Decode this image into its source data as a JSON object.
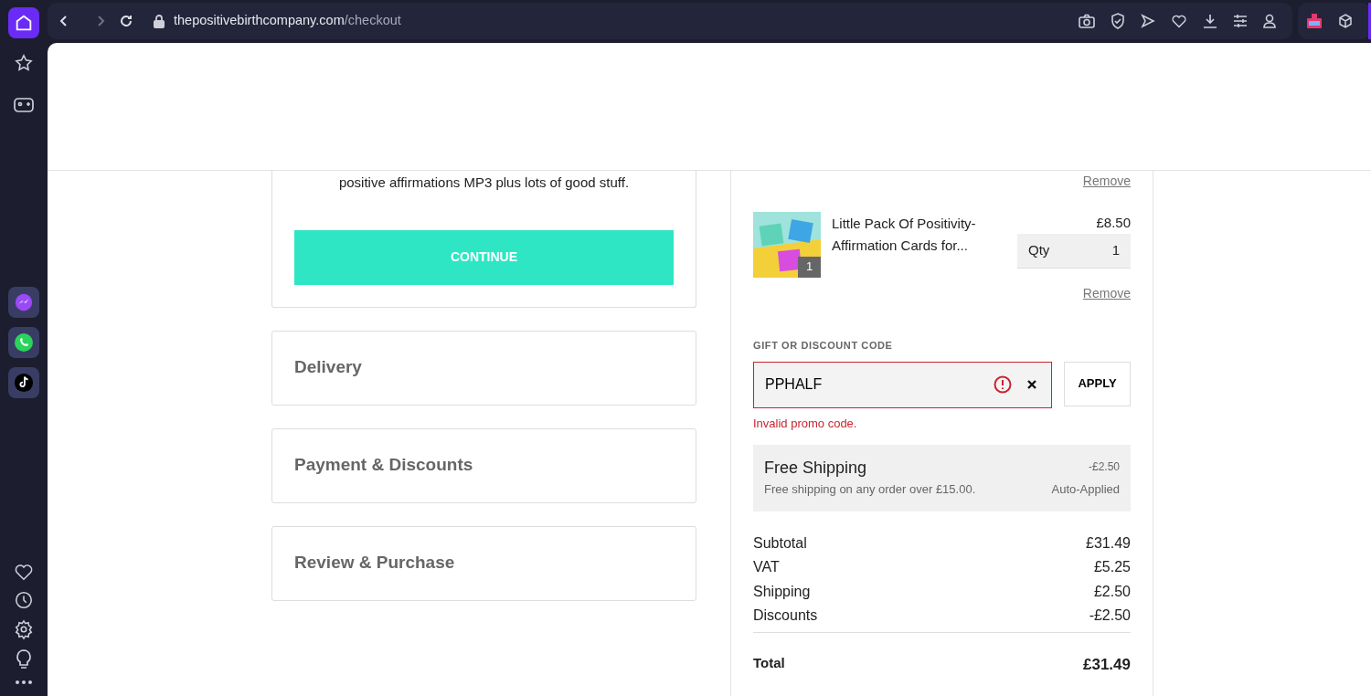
{
  "browser": {
    "url_host": "thepositivebirthcompany.com",
    "url_path": "/checkout"
  },
  "checkout": {
    "intro_text": "positive affirmations MP3 plus lots of good stuff.",
    "continue_button": "CONTINUE",
    "steps": [
      {
        "label": "Delivery"
      },
      {
        "label": "Payment & Discounts"
      },
      {
        "label": "Review & Purchase"
      }
    ]
  },
  "cart": {
    "previous_item_remove": "Remove",
    "items": [
      {
        "name": "Little Pack Of Positivity-Affirmation Cards for...",
        "count": "1",
        "price": "£8.50",
        "qty_label": "Qty",
        "qty": "1",
        "remove": "Remove"
      }
    ],
    "discount": {
      "label": "GIFT OR DISCOUNT CODE",
      "value": "PPHALF",
      "invalid": true,
      "error": "Invalid promo code.",
      "apply": "APPLY"
    },
    "promotion": {
      "title": "Free Shipping",
      "description": "Free shipping on any order over £15.00.",
      "amount": "-£2.50",
      "status": "Auto-Applied"
    },
    "totals": [
      {
        "label": "Subtotal",
        "value": "£31.49"
      },
      {
        "label": "VAT",
        "value": "£5.25"
      },
      {
        "label": "Shipping",
        "value": "£2.50"
      },
      {
        "label": "Discounts",
        "value": "-£2.50"
      }
    ],
    "total": {
      "label": "Total",
      "value": "£31.49"
    }
  }
}
